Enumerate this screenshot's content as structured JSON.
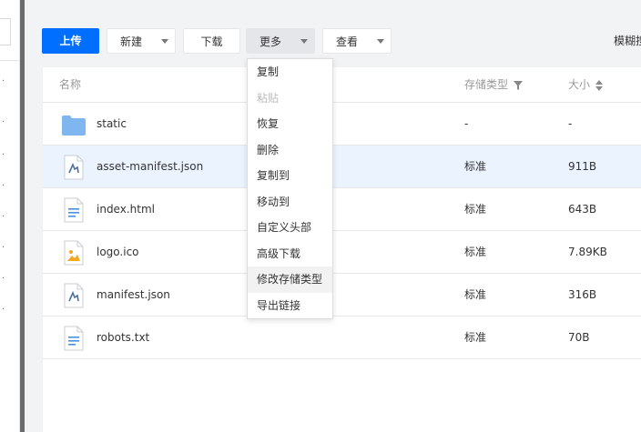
{
  "toolbar": {
    "upload": "上传",
    "new": "新建",
    "download": "下载",
    "more": "更多",
    "view": "查看",
    "search_label": "模糊搜"
  },
  "table": {
    "headers": {
      "name": "名称",
      "storage_type": "存储类型",
      "size": "大小"
    },
    "rows": [
      {
        "name": "static",
        "storage_type": "-",
        "size": "-",
        "icon": "folder-icon"
      },
      {
        "name": "asset-manifest.json",
        "storage_type": "标准",
        "size": "911B",
        "icon": "json-file-icon",
        "selected": true
      },
      {
        "name": "index.html",
        "storage_type": "标准",
        "size": "643B",
        "icon": "document-file-icon"
      },
      {
        "name": "logo.ico",
        "storage_type": "标准",
        "size": "7.89KB",
        "icon": "image-file-icon"
      },
      {
        "name": "manifest.json",
        "storage_type": "标准",
        "size": "316B",
        "icon": "json-file-icon"
      },
      {
        "name": "robots.txt",
        "storage_type": "标准",
        "size": "70B",
        "icon": "document-file-icon"
      }
    ]
  },
  "more_menu": {
    "items": [
      {
        "label": "复制",
        "disabled": false
      },
      {
        "label": "粘贴",
        "disabled": true
      },
      {
        "label": "恢复",
        "disabled": false
      },
      {
        "label": "删除",
        "disabled": false
      },
      {
        "label": "复制到",
        "disabled": false
      },
      {
        "label": "移动到",
        "disabled": false
      },
      {
        "label": "自定义头部",
        "disabled": false
      },
      {
        "label": "高级下载",
        "disabled": false
      },
      {
        "label": "修改存储类型",
        "disabled": false,
        "hovered": true
      },
      {
        "label": "导出链接",
        "disabled": false
      }
    ]
  },
  "colors": {
    "primary": "#006eff",
    "selected_row": "#ebf3ff",
    "folder": "#7fb6f0"
  }
}
